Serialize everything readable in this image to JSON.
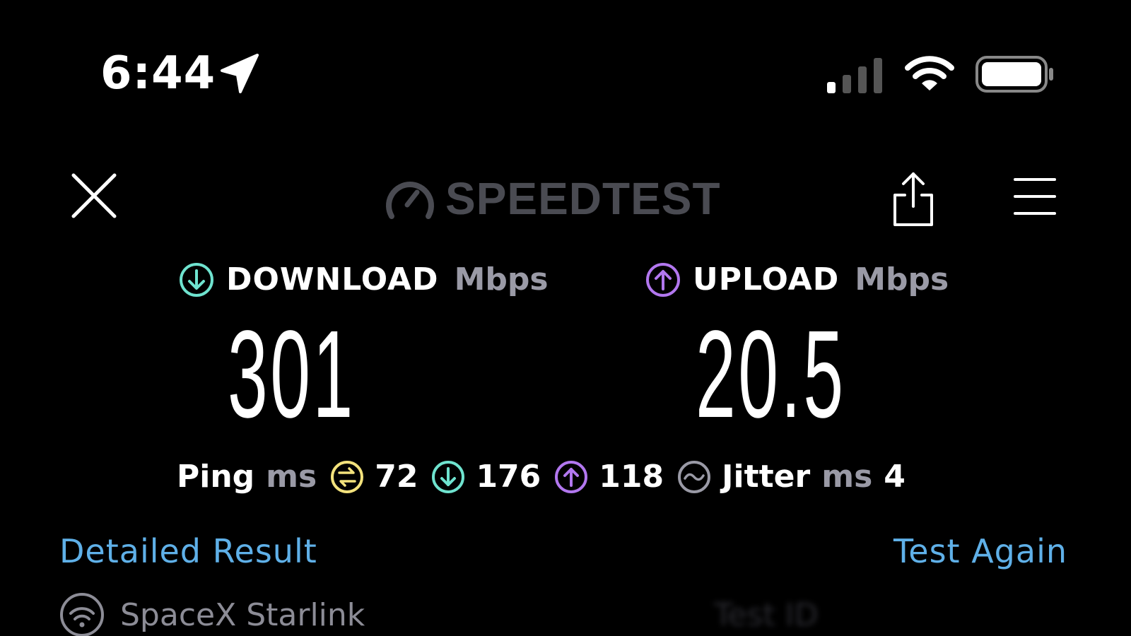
{
  "status_bar": {
    "time": "6:44",
    "icons": [
      "location-arrow-icon",
      "cellular-signal-icon",
      "wifi-icon",
      "battery-icon"
    ]
  },
  "nav": {
    "brand": "SPEEDTEST",
    "icons": [
      "close-icon",
      "speedometer-icon",
      "share-icon",
      "menu-icon"
    ]
  },
  "download": {
    "label": "DOWNLOAD",
    "unit": "Mbps",
    "value": "301",
    "color": "#6fe3cf"
  },
  "upload": {
    "label": "UPLOAD",
    "unit": "Mbps",
    "value": "20.5",
    "color": "#b277ef"
  },
  "ping": {
    "label": "Ping",
    "unit": "ms",
    "idle_value": "72",
    "download_value": "176",
    "upload_value": "118",
    "idle_color": "#f3e27c"
  },
  "jitter": {
    "label": "Jitter",
    "unit": "ms",
    "value": "4"
  },
  "links": {
    "detailed_result": "Detailed Result",
    "test_again": "Test Again",
    "color": "#5fb0e8"
  },
  "provider": {
    "name": "SpaceX Starlink"
  },
  "test_id": {
    "label": "Test ID"
  }
}
